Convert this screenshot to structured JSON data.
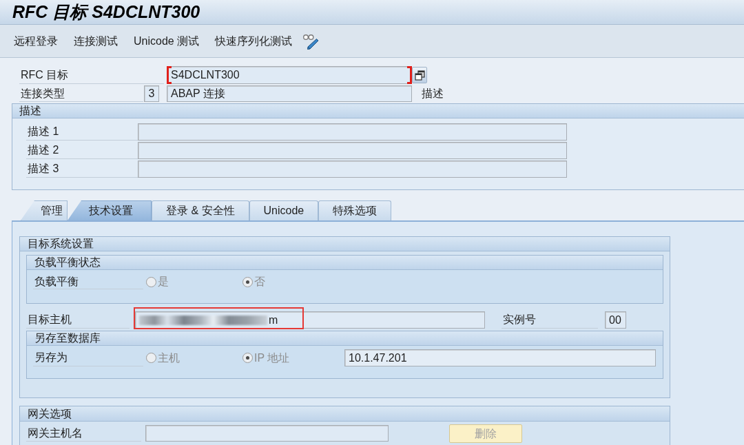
{
  "window": {
    "title": "RFC 目标 S4DCLNT300"
  },
  "toolbar": {
    "items": [
      "远程登录",
      "连接测试",
      "Unicode 测试",
      "快速序列化测试"
    ]
  },
  "header_fields": {
    "rfc_destination": {
      "label": "RFC 目标",
      "value": "S4DCLNT300",
      "focused": true
    },
    "connection_type": {
      "label": "连接类型",
      "code": "3",
      "value": "ABAP 连接",
      "description_label": "描述"
    }
  },
  "description_group": {
    "title": "描述",
    "fields": [
      {
        "label": "描述 1"
      },
      {
        "label": "描述 2"
      },
      {
        "label": "描述 3"
      }
    ]
  },
  "tabs": [
    {
      "label": "管理",
      "selected": false
    },
    {
      "label": "技术设置",
      "selected": true
    },
    {
      "label": "登录 & 安全性",
      "selected": false
    },
    {
      "label": "Unicode",
      "selected": false
    },
    {
      "label": "特殊选项",
      "selected": false
    }
  ],
  "target_system": {
    "title": "目标系统设置",
    "load_balancing": {
      "title": "负载平衡状态",
      "label": "负载平衡",
      "disabled": true,
      "options": [
        {
          "label": "是",
          "selected": false
        },
        {
          "label": "否",
          "selected": true
        }
      ]
    },
    "target_host": {
      "label": "目标主机",
      "value": "m",
      "redacted": true,
      "highlighted": true
    },
    "instance_number": {
      "label": "实例号",
      "value": "00"
    },
    "save_to_db": {
      "title": "另存至数据库",
      "label": "另存为",
      "disabled": true,
      "options": [
        {
          "label": "主机",
          "selected": false
        },
        {
          "label": "IP 地址",
          "selected": true
        }
      ],
      "value": "10.1.47.201"
    }
  },
  "gateway": {
    "title": "网关选项",
    "host": {
      "label": "网关主机名"
    },
    "button": {
      "label": "删除",
      "disabled": true
    }
  }
}
